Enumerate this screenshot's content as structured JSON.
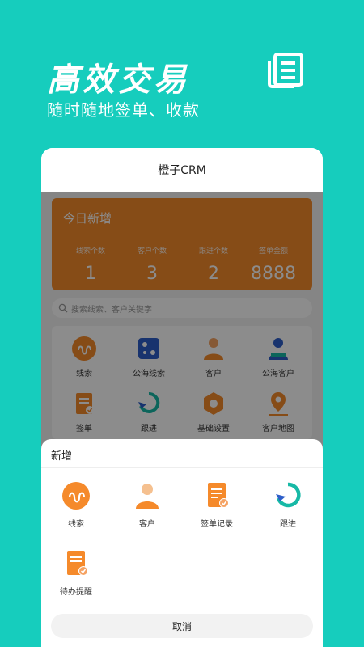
{
  "promo": {
    "title": "高效交易",
    "subtitle": "随时随地签单、收款"
  },
  "app": {
    "title": "橙子CRM"
  },
  "stats": {
    "title": "今日新增",
    "items": [
      {
        "label": "线索个数",
        "value": "1"
      },
      {
        "label": "客户个数",
        "value": "3"
      },
      {
        "label": "跟进个数",
        "value": "2"
      },
      {
        "label": "签单金额",
        "value": "8888"
      }
    ]
  },
  "search": {
    "placeholder": "搜索线索、客户关键字"
  },
  "grid": {
    "items": [
      {
        "label": "线索",
        "icon": "lead-icon"
      },
      {
        "label": "公海线索",
        "icon": "public-lead-icon"
      },
      {
        "label": "客户",
        "icon": "customer-icon"
      },
      {
        "label": "公海客户",
        "icon": "public-customer-icon"
      },
      {
        "label": "签单",
        "icon": "contract-icon"
      },
      {
        "label": "跟进",
        "icon": "follow-up-icon"
      },
      {
        "label": "基础设置",
        "icon": "settings-icon"
      },
      {
        "label": "客户地图",
        "icon": "map-pin-icon"
      }
    ]
  },
  "sheet": {
    "title": "新增",
    "items": [
      {
        "label": "线索",
        "icon": "lead-icon"
      },
      {
        "label": "客户",
        "icon": "customer-icon"
      },
      {
        "label": "签单记录",
        "icon": "contract-record-icon"
      },
      {
        "label": "跟进",
        "icon": "follow-up-icon"
      },
      {
        "label": "待办提醒",
        "icon": "todo-reminder-icon"
      }
    ],
    "cancel_label": "取消"
  },
  "colors": {
    "background": "#16cdbd",
    "accent": "#f58a2b",
    "blue": "#2d5ec9",
    "teal": "#17b9a6"
  }
}
